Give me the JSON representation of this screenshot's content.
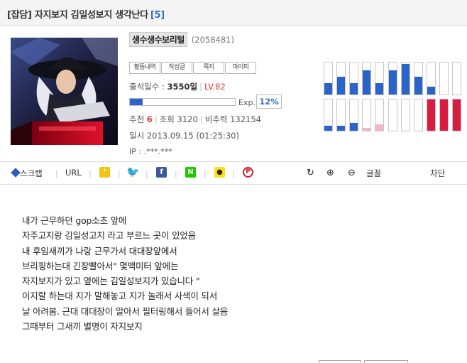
{
  "post": {
    "title": "[잡담] 자지보지 김일성보지 생각난다",
    "comment_count": "[5]"
  },
  "author": {
    "nickname": "생수생수보리털",
    "user_id": "(2058481)",
    "buttons": [
      "활동내역",
      "작성글",
      "쪽지",
      "마이피"
    ],
    "attendance_label": "출석일수 : ",
    "attendance_value": "3550일",
    "level": "LV.82",
    "exp_label": "Exp.",
    "exp_percent": "12%",
    "exp_fraction": 0.12
  },
  "stats": {
    "recommend_label": "추천",
    "recommend_value": "6",
    "views": "조회 3120",
    "nonrecommend": "비추력 132154",
    "date": "일시 2013.09.15 (01:25:30)",
    "ip": "IP : .***.***"
  },
  "activity_graph": {
    "top_row": [
      0.35,
      0.55,
      0.35,
      0.75,
      0.35,
      0.75,
      0.95,
      0.55,
      0.25,
      0,
      0
    ],
    "bottom_row": [
      0.15,
      0.15,
      0.25,
      0.1,
      0.2,
      0,
      0,
      0,
      1,
      1,
      1
    ],
    "bottom_colors": [
      "#2a64c8",
      "#2a64c8",
      "#2a64c8",
      "#f4b6c8",
      "#f4b6c8",
      "#ffffff",
      "#ffffff",
      "#ffffff",
      "#d91c40",
      "#d91c40",
      "#d91c40"
    ],
    "blue": "#2a64c8"
  },
  "share_bar": {
    "scrap": "스크랩",
    "url": "URL",
    "font": "글꼴",
    "block": "차단"
  },
  "body_text": "내가 근무하던 gop소초 앞에\n자주고지랑 김일성고지 라고 부르느 곳이 있었음\n내 후임새끼가 나랑 근무가서 대대장앞에서\n브리핑하는대 긴장빨아서\" 몇백미터 앞에는\n자지보지가 있고 옆에는 김일성보지가 있습니다 \"\n이지랄 하는대 지가 말해놓고 지가 놀래서 사색이 되서\n날 아려봄. 근대 대대장이 알아서 필터링해서 들어서 살음\n그때부터 그새끼 별명이 자지보지"
}
